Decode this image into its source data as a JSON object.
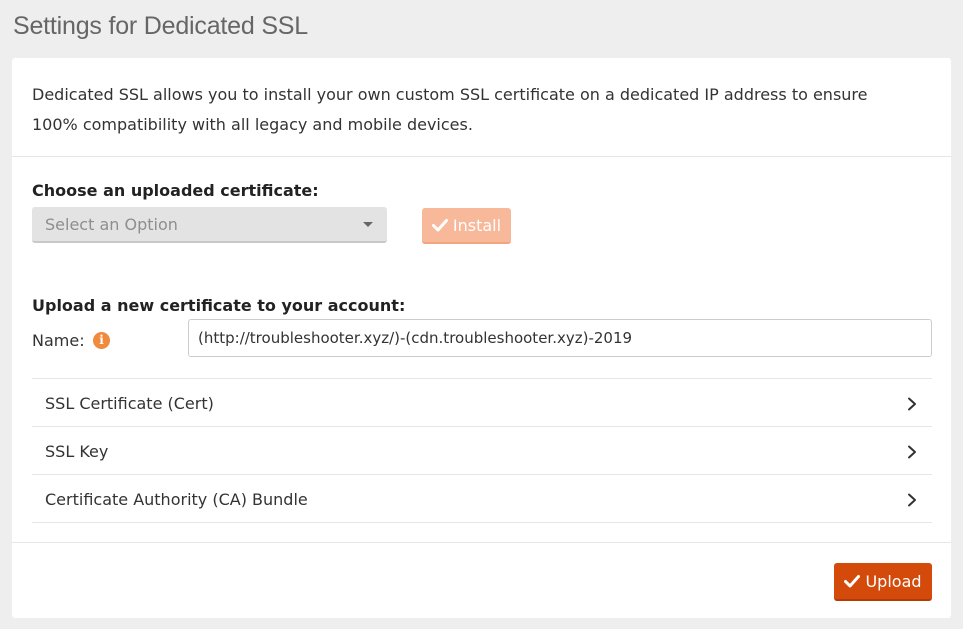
{
  "page": {
    "title": "Settings for Dedicated SSL"
  },
  "intro": {
    "text": "Dedicated SSL allows you to install your own custom SSL certificate on a dedicated IP address to ensure 100% compatibility with all legacy and mobile devices."
  },
  "choose_section": {
    "label": "Choose an uploaded certificate:",
    "select_placeholder": "Select an Option",
    "install_label": "Install"
  },
  "upload_section": {
    "label": "Upload a new certificate to your account:",
    "name_label": "Name:",
    "name_value": "(http://troubleshooter.xyz/)-(cdn.troubleshooter.xyz)-2019",
    "info_icon": "info-icon",
    "rows": [
      {
        "label": "SSL Certificate (Cert)"
      },
      {
        "label": "SSL Key"
      },
      {
        "label": "Certificate Authority (CA) Bundle"
      }
    ],
    "upload_label": "Upload"
  },
  "colors": {
    "accent": "#d44a0b",
    "install_disabled": "#f7b99a",
    "info": "#f08a3c"
  }
}
